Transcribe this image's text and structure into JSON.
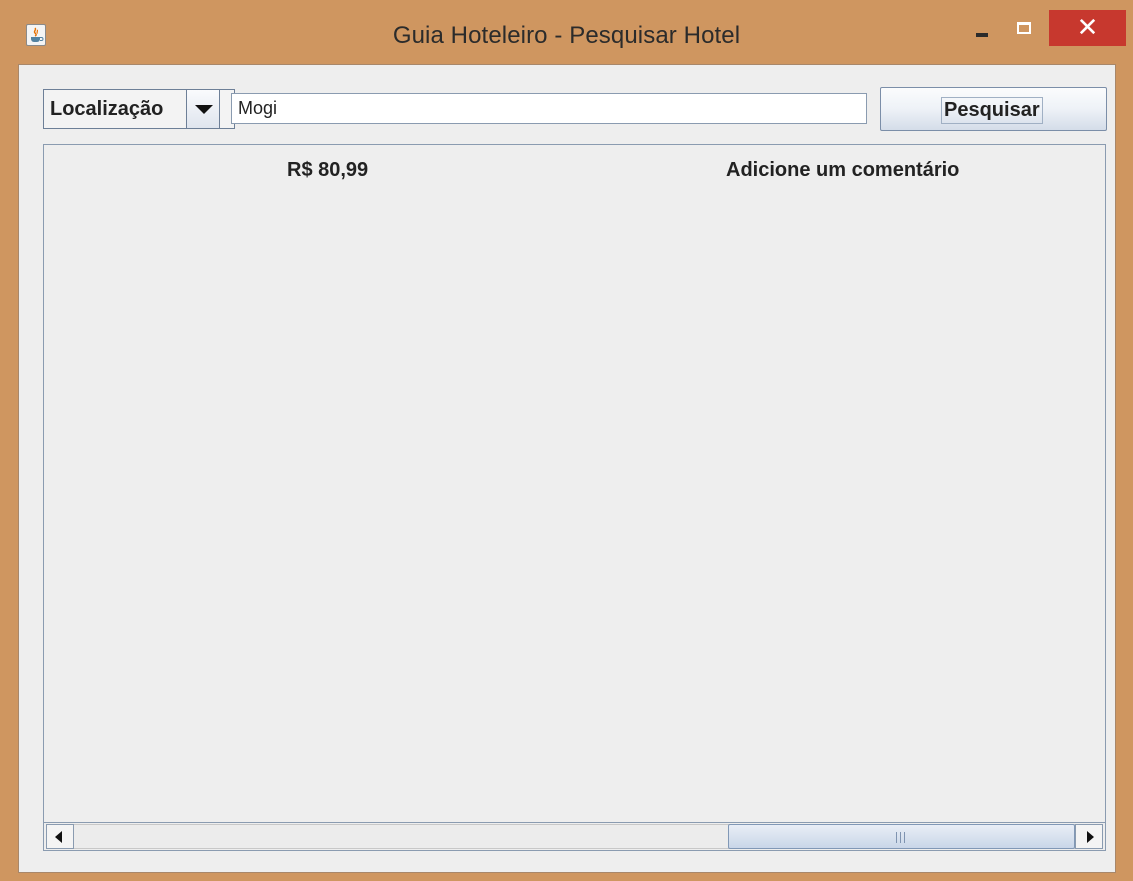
{
  "window": {
    "title": "Guia Hoteleiro - Pesquisar Hotel",
    "icons": {
      "app": "java-cup-icon",
      "minimize": "minimize-icon",
      "maximize": "maximize-icon",
      "close": "close-icon"
    },
    "close_symbol": "✕",
    "colors": {
      "frame": "#cf9660",
      "close_button": "#c7382e",
      "client_background": "#eeeeee"
    }
  },
  "search": {
    "filter_selected": "Localização",
    "query_value": "Mogi",
    "button_label": "Pesquisar"
  },
  "results": {
    "rows": [
      {
        "price": "R$ 80,99",
        "comment_link": "Adicione um comentário"
      }
    ]
  },
  "scrollbar": {
    "horizontal_position_fraction": 0.68,
    "thumb_fraction": 0.35
  }
}
